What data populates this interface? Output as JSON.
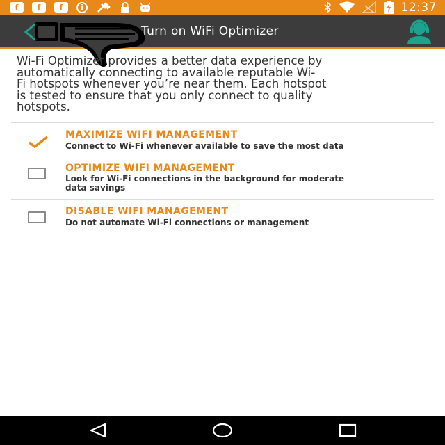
{
  "status_bar": {
    "time": "12:37",
    "left_icons": [
      "facebook-icon",
      "facebook-icon",
      "facebook-icon",
      "info-icon",
      "tools-icon",
      "lock-icon",
      "android-icon"
    ],
    "right_icons": [
      "bluetooth-icon",
      "wifi-icon",
      "no-signal-icon",
      "battery-charging-icon"
    ]
  },
  "app_bar": {
    "title": "Turn on WiFi Optimizer",
    "back_icon": "chevron-left-icon",
    "action_icon": "support-agent-icon"
  },
  "intro_text": "Wi-Fi Optimizer provides a better data experience by automatically connecting to available reputable Wi-Fi hotspots whenever you’re near them. Each hotspot is tested to ensure that you only connect to quality hotspots.",
  "intro_lines": [
    "Wi-Fi Optimizer provides a better data experience by",
    "automatically connecting to available reputable Wi-",
    "Fi hotspots whenever you’re near them. Each hotspot",
    "is tested to ensure that you only connect to quality",
    "hotspots."
  ],
  "options": [
    {
      "title": "MAXIMIZE WIFI MANAGEMENT",
      "description": "Connect to Wi-Fi whenever available to save the most data",
      "selected": true
    },
    {
      "title": "OPTIMIZE WIFI MANAGEMENT",
      "description_lines": [
        "Look for Wi-Fi connections in the background for moderate",
        "data savings"
      ],
      "selected": false
    },
    {
      "title": "DISABLE WIFI MANAGEMENT",
      "description": "Do not automate Wi-Fi connections or management",
      "selected": false
    }
  ],
  "nav_bar": {
    "icons": [
      "back-triangle-icon",
      "home-circle-icon",
      "recents-square-icon"
    ]
  },
  "colors": {
    "accent": "#e8891a",
    "app_bar": "#3c3c3c",
    "teal": "#1ba38e",
    "nav_bar": "#000000"
  }
}
